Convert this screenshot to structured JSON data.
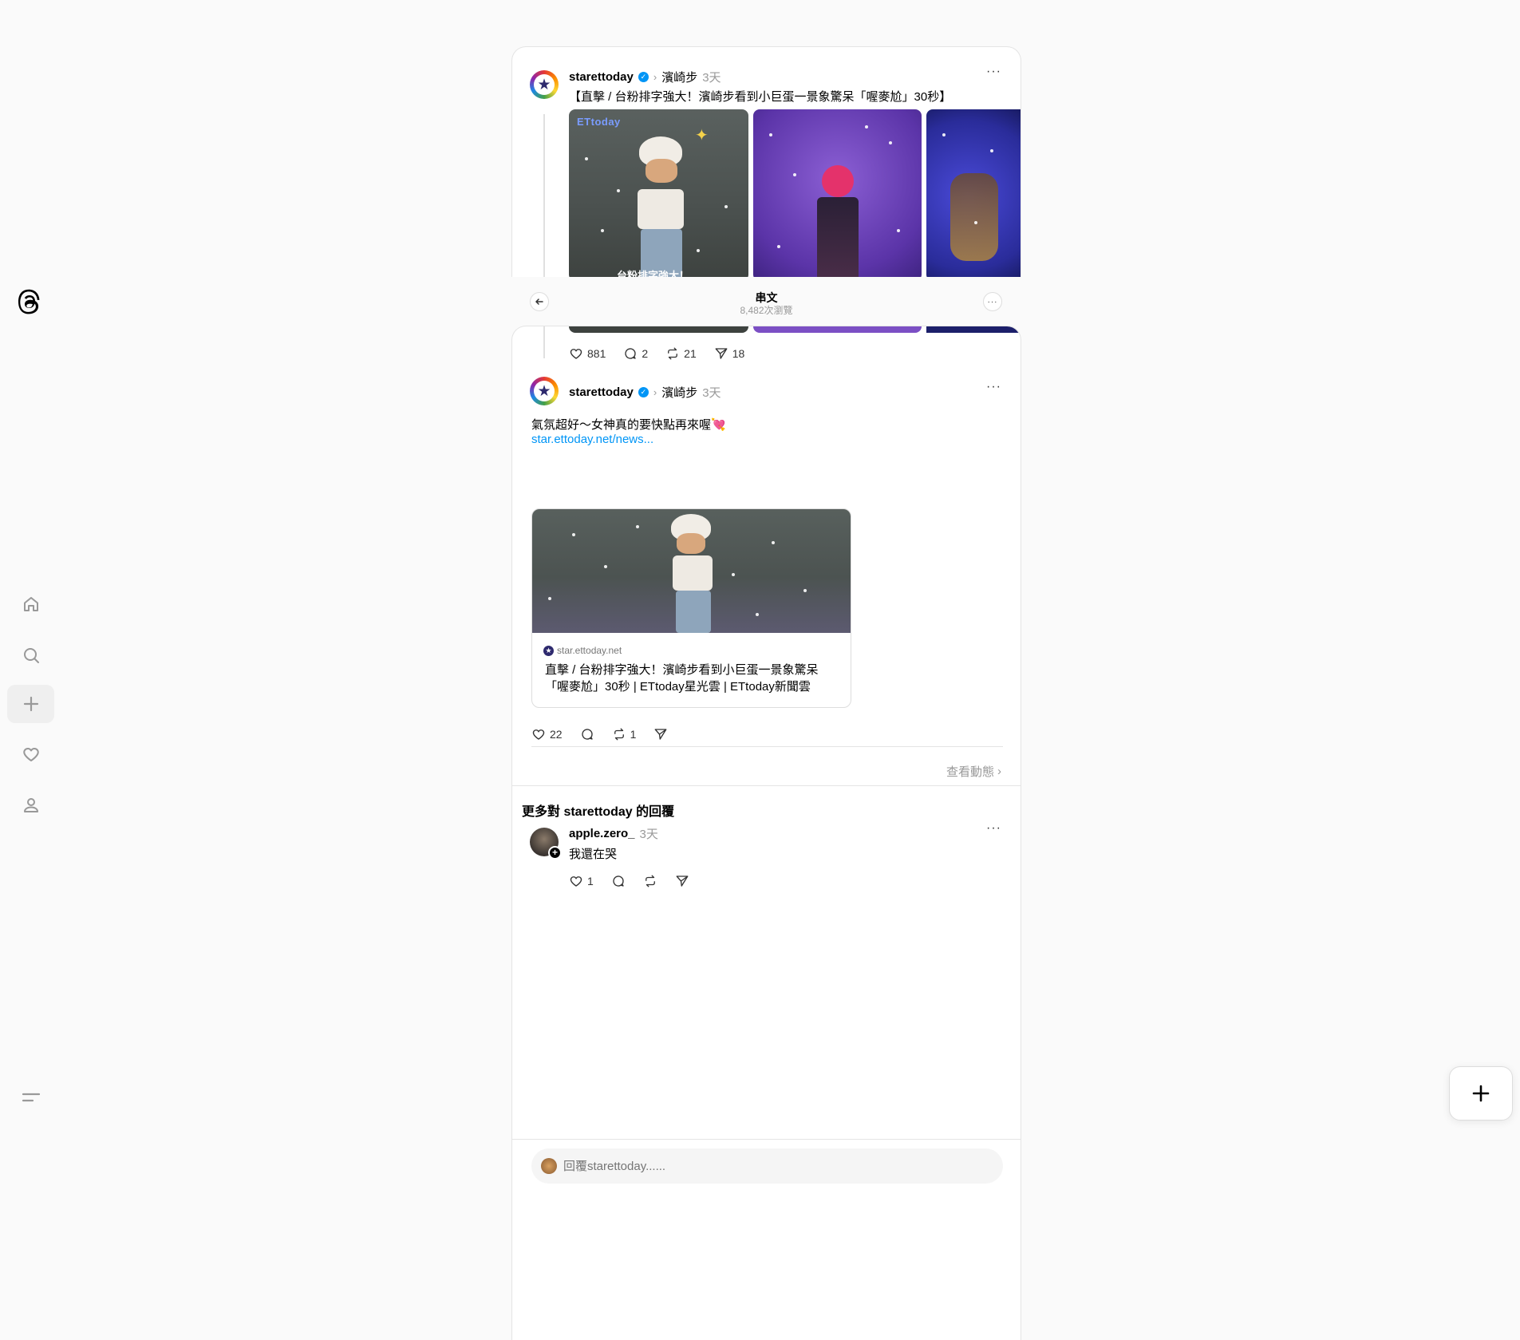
{
  "header": {
    "title": "串文",
    "subtitle": "8,482次瀏覽"
  },
  "top_post": {
    "username": "starettoday",
    "tag": "濱崎步",
    "time": "3天",
    "text": "【直擊 / 台粉排字強大！濱崎步看到小巨蛋一景象驚呆「喔麥尬」30秒】",
    "image_watermark": "ETtoday",
    "image_caption_partial": "台粉排字強大！",
    "likes": "881",
    "comments": "2",
    "reposts": "21",
    "shares": "18"
  },
  "reply_post": {
    "username": "starettoday",
    "tag": "濱崎步",
    "time": "3天",
    "text": "氣氛超好～女神真的要快點再來喔💘",
    "link_text": "star.ettoday.net/news...",
    "link_card": {
      "domain": "star.ettoday.net",
      "title": "直擊 / 台粉排字強大！濱崎步看到小巨蛋一景象驚呆「喔麥尬」30秒 | ETtoday星光雲 | ETtoday新聞雲"
    },
    "likes": "22",
    "comments": "",
    "reposts": "1",
    "shares": "",
    "view_activity": "查看動態"
  },
  "more_replies": {
    "heading": "更多對 starettoday 的回覆",
    "items": [
      {
        "username": "apple.zero_",
        "time": "3天",
        "text": "我還在哭",
        "likes": "1",
        "comments": "",
        "reposts": "",
        "shares": ""
      }
    ]
  },
  "reply_input": {
    "placeholder": "回覆starettoday......"
  },
  "icons": {
    "logo": "threads-logo-icon",
    "home": "home-icon",
    "search": "search-icon",
    "create": "plus-icon",
    "activity": "heart-icon",
    "profile": "person-icon",
    "menu": "menu-icon"
  },
  "colors": {
    "accent_link": "#0095f6",
    "verified": "#0095f6",
    "background": "#fafafa"
  }
}
